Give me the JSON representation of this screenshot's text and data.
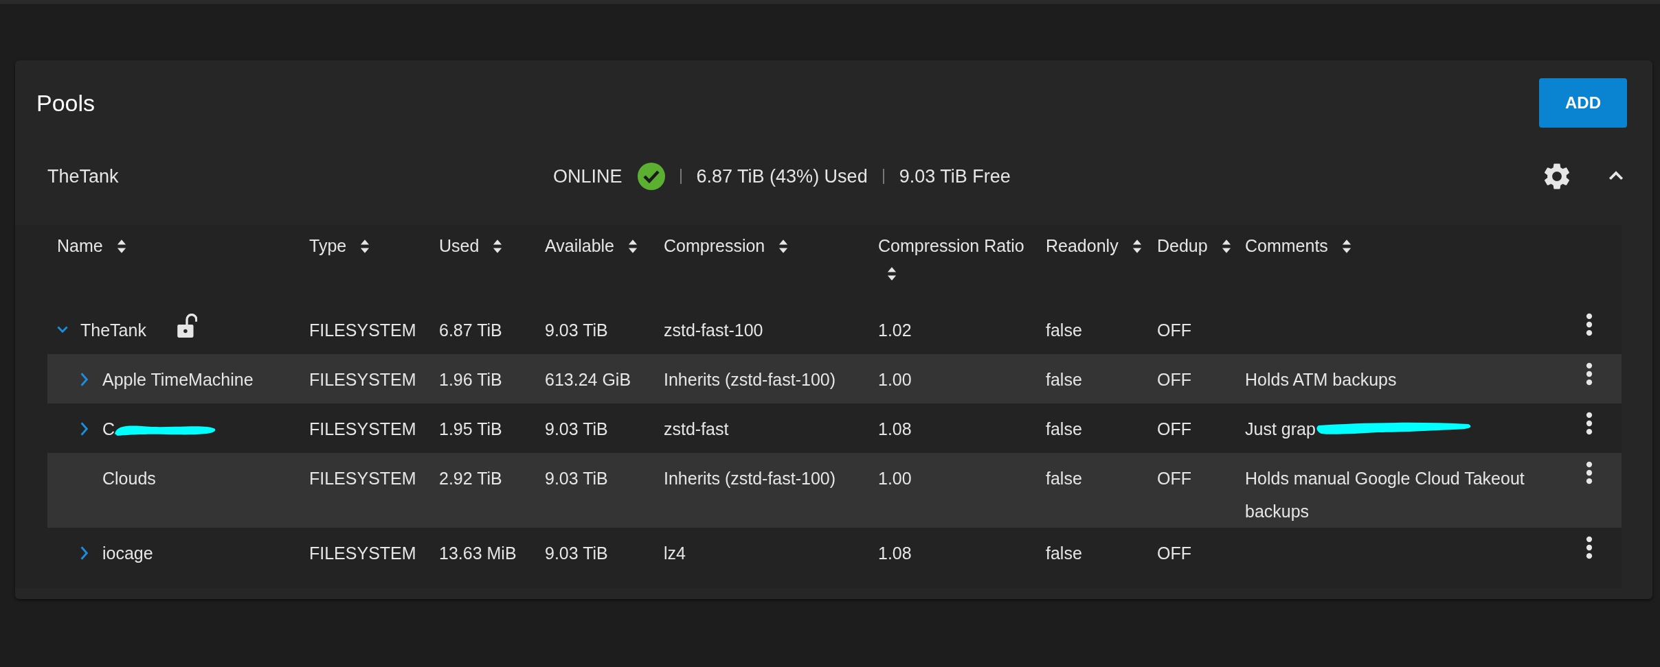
{
  "title": "Pools",
  "add_button": "ADD",
  "pool": {
    "name": "TheTank",
    "status": "ONLINE",
    "healthy": true,
    "used": "6.87 TiB (43%) Used",
    "free": "9.03 TiB Free",
    "expanded": true
  },
  "table": {
    "columns": [
      "Name",
      "Type",
      "Used",
      "Available",
      "Compression",
      "Compression Ratio",
      "Readonly",
      "Dedup",
      "Comments"
    ],
    "rows": [
      {
        "name": "TheTank",
        "locked": false,
        "expanded": true,
        "type": "FILESYSTEM",
        "used": "6.87 TiB",
        "available": "9.03 TiB",
        "compression": "zstd-fast-100",
        "ratio": "1.02",
        "readonly": "false",
        "dedup": "OFF",
        "children": [
          {
            "name": "Apple TimeMachine",
            "expanded": false,
            "type": "FILESYSTEM",
            "used": "1.96 TiB",
            "available": "613.24 GiB",
            "compression": "Inherits (zstd-fast-100)",
            "ratio": "1.00",
            "readonly": "false",
            "dedup": "OFF",
            "comments": "Holds ATM backups"
          },
          {
            "name": "C",
            "name_redacted": true,
            "expanded": false,
            "type": "FILESYSTEM",
            "used": "1.95 TiB",
            "available": "9.03 TiB",
            "compression": "zstd-fast",
            "ratio": "1.08",
            "readonly": "false",
            "dedup": "OFF",
            "comments": "Just grap",
            "comments_redacted": true
          },
          {
            "name": "Clouds",
            "type": "FILESYSTEM",
            "used": "2.92 TiB",
            "available": "9.03 TiB",
            "compression": "Inherits (zstd-fast-100)",
            "ratio": "1.00",
            "readonly": "false",
            "dedup": "OFF",
            "comments": "Holds manual Google Cloud Takeout backups"
          },
          {
            "name": "iocage",
            "expanded": false,
            "type": "FILESYSTEM",
            "used": "13.63 MiB",
            "available": "9.03 TiB",
            "compression": "lz4",
            "ratio": "1.08",
            "readonly": "false",
            "dedup": "OFF"
          }
        ]
      }
    ]
  }
}
